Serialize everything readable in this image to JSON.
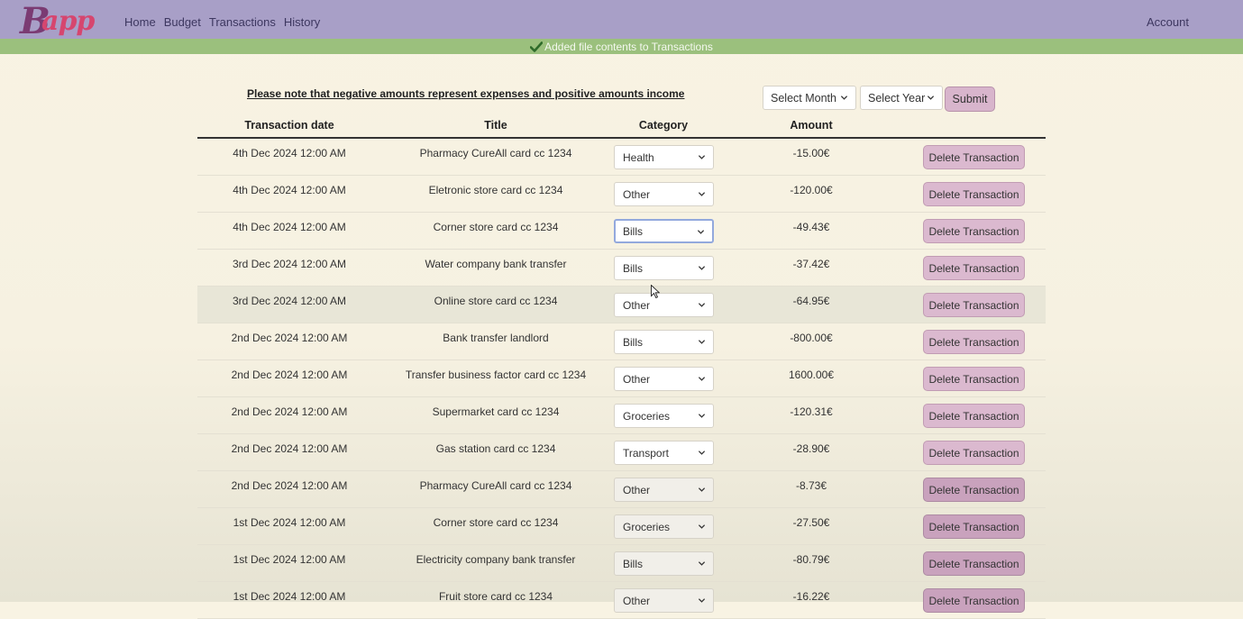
{
  "nav": {
    "logo_b": "B",
    "logo_rest": "app",
    "links": [
      "Home",
      "Budget",
      "Transactions",
      "History"
    ],
    "account": "Account"
  },
  "banner": {
    "icon": "check-icon",
    "message": "Added file contents to Transactions"
  },
  "note": "Please note that negative amounts represent expenses and positive amounts income",
  "filters": {
    "month_label": "Select Month",
    "year_label": "Select Year",
    "submit_label": "Submit"
  },
  "table": {
    "headers": [
      "Transaction date",
      "Title",
      "Category",
      "Amount"
    ],
    "delete_label": "Delete Transaction",
    "rows": [
      {
        "date": "4th Dec 2024 12:00 AM",
        "title": "Pharmacy CureAll card cc 1234",
        "category": "Health",
        "amount": "-15.00€"
      },
      {
        "date": "4th Dec 2024 12:00 AM",
        "title": "Eletronic store card cc 1234",
        "category": "Other",
        "amount": "-120.00€"
      },
      {
        "date": "4th Dec 2024 12:00 AM",
        "title": "Corner store card cc 1234",
        "category": "Bills",
        "amount": "-49.43€"
      },
      {
        "date": "3rd Dec 2024 12:00 AM",
        "title": "Water company bank transfer",
        "category": "Bills",
        "amount": "-37.42€"
      },
      {
        "date": "3rd Dec 2024 12:00 AM",
        "title": "Online store card cc 1234",
        "category": "Other",
        "amount": "-64.95€"
      },
      {
        "date": "2nd Dec 2024 12:00 AM",
        "title": "Bank transfer landlord",
        "category": "Bills",
        "amount": "-800.00€"
      },
      {
        "date": "2nd Dec 2024 12:00 AM",
        "title": "Transfer business factor card cc 1234",
        "category": "Other",
        "amount": "1600.00€"
      },
      {
        "date": "2nd Dec 2024 12:00 AM",
        "title": "Supermarket card cc 1234",
        "category": "Groceries",
        "amount": "-120.31€"
      },
      {
        "date": "2nd Dec 2024 12:00 AM",
        "title": "Gas station card cc 1234",
        "category": "Transport",
        "amount": "-28.90€"
      },
      {
        "date": "2nd Dec 2024 12:00 AM",
        "title": "Pharmacy CureAll card cc 1234",
        "category": "Other",
        "amount": "-8.73€"
      },
      {
        "date": "1st Dec 2024 12:00 AM",
        "title": "Corner store card cc 1234",
        "category": "Groceries",
        "amount": "-27.50€"
      },
      {
        "date": "1st Dec 2024 12:00 AM",
        "title": "Electricity company bank transfer",
        "category": "Bills",
        "amount": "-80.79€"
      },
      {
        "date": "1st Dec 2024 12:00 AM",
        "title": "Fruit store card cc 1234",
        "category": "Other",
        "amount": "-16.22€"
      }
    ]
  },
  "colors": {
    "navbar": "#a89fc7",
    "banner": "#9bc07d",
    "button": "#dbb9cf",
    "logo_primary": "#7b3b73",
    "logo_accent": "#d6466f"
  }
}
